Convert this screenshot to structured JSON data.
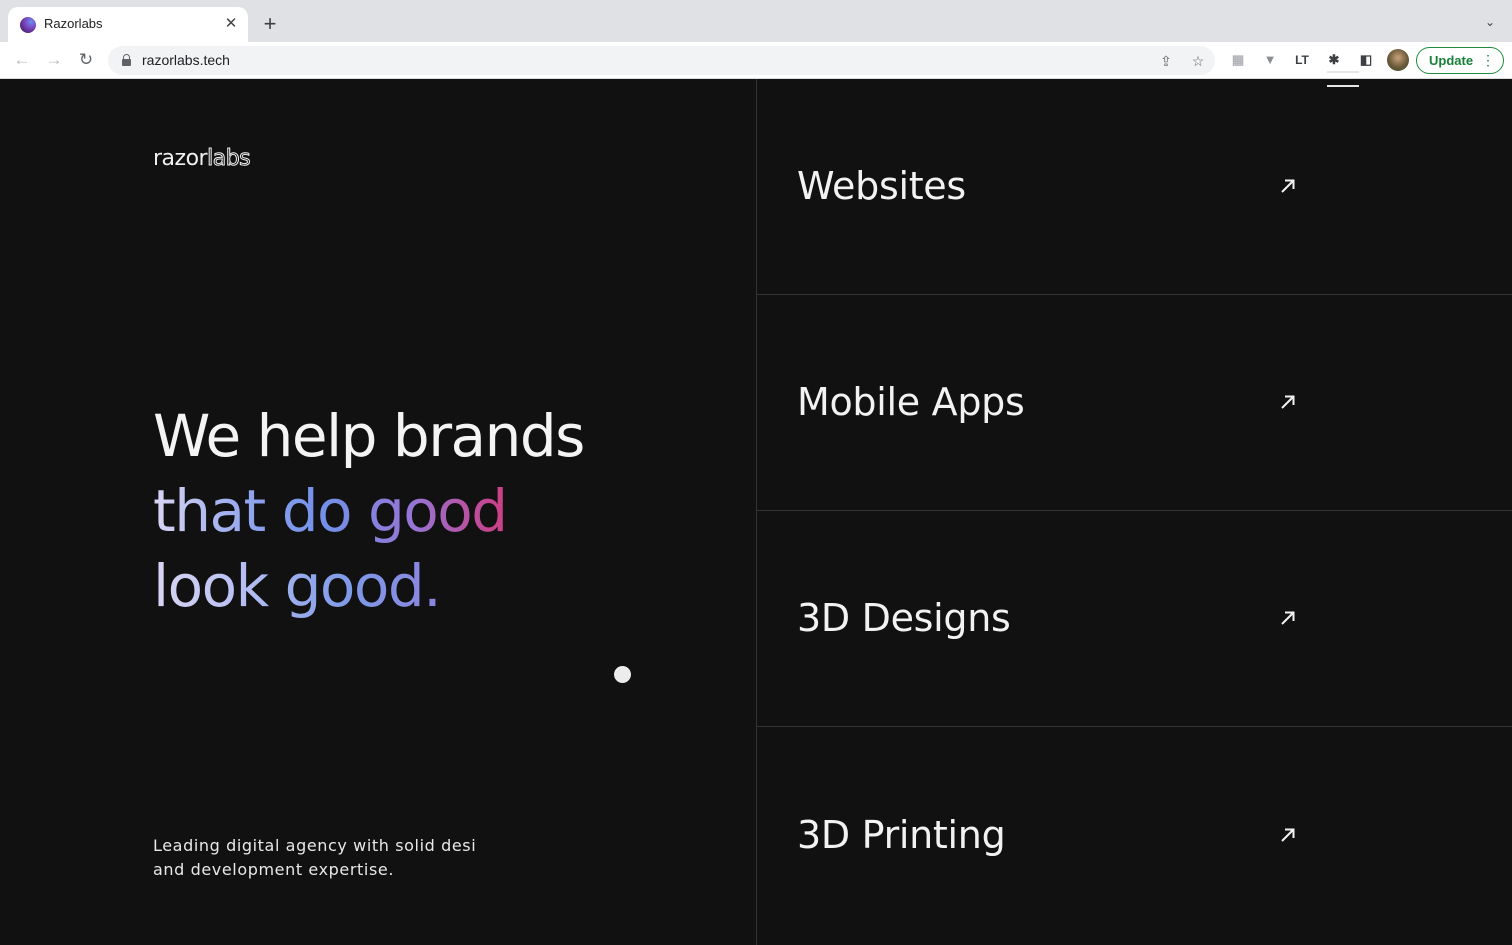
{
  "browser": {
    "tab_title": "Razorlabs",
    "tab_close": "✕",
    "new_tab": "+",
    "tab_search": "⌄",
    "url": "razorlabs.tech",
    "update_label": "Update",
    "update_menu": "⋮",
    "nav": {
      "back": "←",
      "forward": "→",
      "reload": "↻"
    },
    "omnibox_icons": {
      "share": "⇪",
      "bookmark": "☆"
    },
    "extensions": [
      "▦",
      "▼",
      "LT",
      "✱",
      "◧"
    ]
  },
  "page": {
    "logo_part1": "razor",
    "logo_part2": "labs",
    "headline": {
      "line1": "We help brands",
      "line2": "that do good",
      "line3": "look good."
    },
    "tagline_line1": "Leading digital agency with solid desi",
    "tagline_line2": "and development expertise.",
    "services": [
      {
        "label": "Websites"
      },
      {
        "label": "Mobile Apps"
      },
      {
        "label": "3D Designs"
      },
      {
        "label": "3D Printing"
      }
    ]
  },
  "colors": {
    "background": "#111111",
    "divider": "#333333",
    "text": "#f2f2f2",
    "gradient": [
      "#d9d6f2",
      "#7390e8",
      "#9576d6",
      "#e0346f"
    ],
    "update_green": "#188038"
  }
}
